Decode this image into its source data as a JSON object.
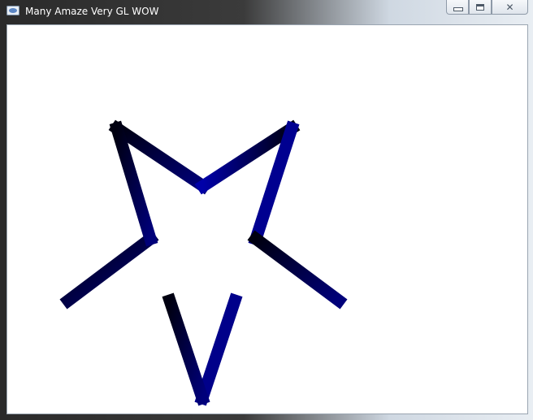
{
  "window": {
    "title": "Many Amaze Very GL WOW",
    "icon": "opengl-app-icon",
    "controls": {
      "minimize": "minimize-icon",
      "maximize": "maximize-icon",
      "close": "close-icon",
      "close_glyph": "✕"
    }
  },
  "canvas": {
    "background": "#ffffff",
    "shape": "five-point-star-outline",
    "colors": [
      "#000010",
      "#0a0a8a",
      "#0000a8",
      "#00006a"
    ]
  }
}
